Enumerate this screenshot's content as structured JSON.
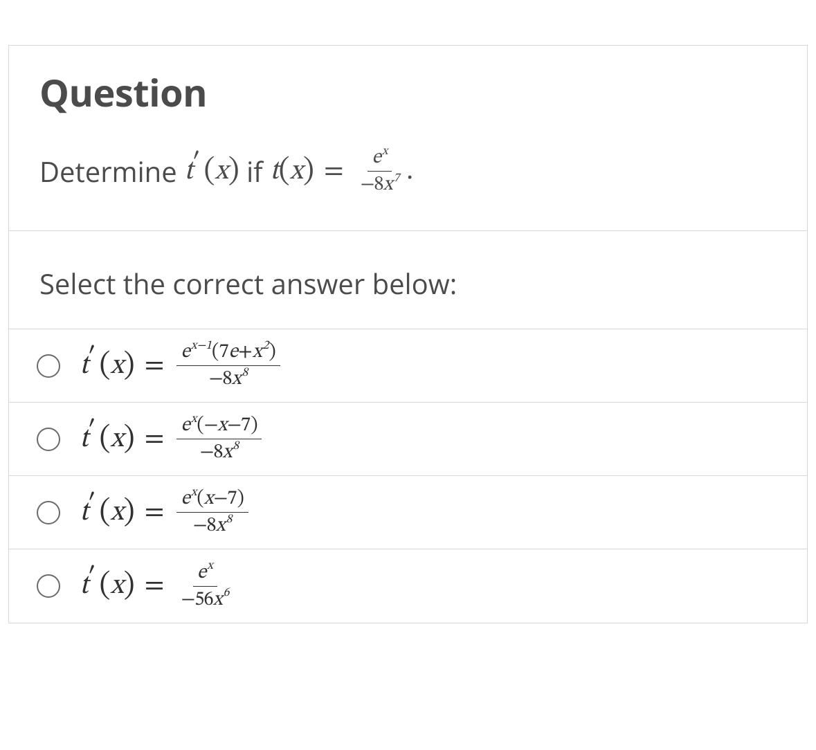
{
  "question": {
    "heading": "Question",
    "prompt_prefix": "Determine",
    "prompt_infix": "if",
    "select_text": "Select the correct answer below:"
  },
  "math": {
    "t": "t",
    "prime": "′",
    "x": "x",
    "e": "e",
    "equals": "=",
    "lparen": "(",
    "rparen": ")",
    "period": ".",
    "minus": "−",
    "plus": "+"
  },
  "given": {
    "num": "e",
    "num_exp": "x",
    "den_coef": "−8",
    "den_var": "x",
    "den_exp": "7"
  },
  "options": {
    "a": {
      "num_e_exp": "x−1",
      "num_paren": "7e+x",
      "num_paren_exp": "2",
      "den_coef": "−8",
      "den_var": "x",
      "den_exp": "8"
    },
    "b": {
      "num_e_exp": "x",
      "num_paren": "−x−7",
      "den_coef": "−8",
      "den_var": "x",
      "den_exp": "8"
    },
    "c": {
      "num_e_exp": "x",
      "num_paren": "x−7",
      "den_coef": "−8",
      "den_var": "x",
      "den_exp": "8"
    },
    "d": {
      "num_e": "e",
      "num_e_exp": "x",
      "den_coef": "−56",
      "den_var": "x",
      "den_exp": "6"
    }
  }
}
